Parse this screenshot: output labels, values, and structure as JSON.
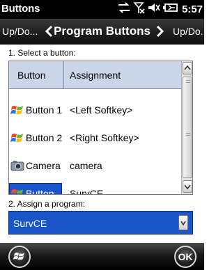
{
  "statusbar": {
    "title": "Buttons",
    "time": "5:57"
  },
  "nav": {
    "prev": "Up/Do...",
    "title": "Program Buttons",
    "next": "Up/Do..."
  },
  "section1": {
    "label": "1. Select a button:"
  },
  "table": {
    "headers": [
      "Button",
      "Assignment"
    ],
    "rows": [
      {
        "button": "Button 1",
        "assignment": "<Left Softkey>",
        "icon": "windows-flag-icon"
      },
      {
        "button": "Button 2",
        "assignment": "<Right Softkey>",
        "icon": "windows-flag-icon"
      },
      {
        "button": "Camera",
        "assignment": "camera",
        "icon": "camera-icon"
      },
      {
        "button": "Button",
        "assignment": "SurvCE",
        "icon": "windows-flag-icon",
        "selected": true
      }
    ]
  },
  "section2": {
    "label": "2. Assign a program:"
  },
  "program_select": {
    "value": "SurvCE"
  },
  "bottombar": {
    "ok_label": "OK"
  },
  "colors": {
    "selection": "#1a56c9",
    "header": "#cbd5e8"
  }
}
